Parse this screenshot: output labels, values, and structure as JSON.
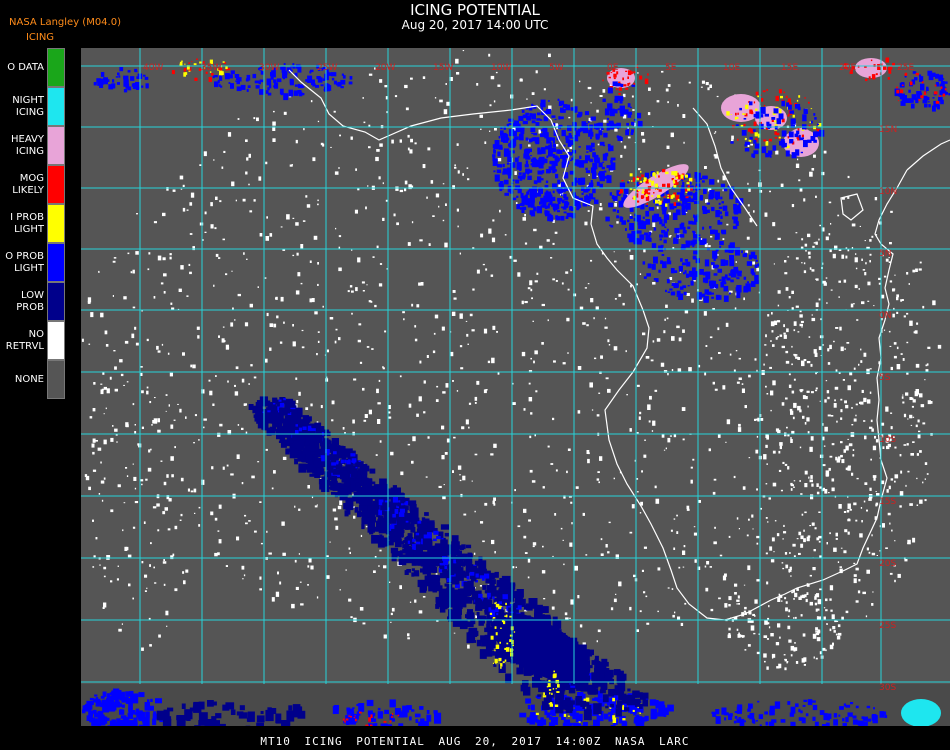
{
  "header": {
    "title": "ICING POTENTIAL",
    "subtitle": "Aug 20, 2017 14:00 UTC",
    "provider": "NASA Langley (M04.0)",
    "product": "ICING"
  },
  "legend": {
    "items": [
      {
        "line1": "O DATA",
        "line2": "",
        "color": "#1aa61a"
      },
      {
        "line1": "NIGHT",
        "line2": "ICING",
        "color": "#1ee6ef"
      },
      {
        "line1": "HEAVY",
        "line2": "ICING",
        "color": "#e8a4d8"
      },
      {
        "line1": "MOG",
        "line2": "LIKELY",
        "color": "#ff0000"
      },
      {
        "line1": "I PROB",
        "line2": "LIGHT",
        "color": "#ffff00"
      },
      {
        "line1": "O PROB",
        "line2": "LIGHT",
        "color": "#0000ff"
      },
      {
        "line1": "LOW",
        "line2": "PROB",
        "color": "#00008b"
      },
      {
        "line1": "NO",
        "line2": "RETRVL",
        "color": "#ffffff"
      },
      {
        "line1": "NONE",
        "line2": "",
        "color": "#555555"
      }
    ]
  },
  "map": {
    "background_color": "#555555",
    "grid_color": "#26d3d9",
    "coastline_color": "#ffffff",
    "label_color": "#cc2222",
    "lon_labels": [
      "40W",
      "35W",
      "30W",
      "25W",
      "20W",
      "15W",
      "10W",
      "5W",
      "0E",
      "5E",
      "10E",
      "15E",
      "20E",
      "25E",
      "30E"
    ],
    "lat_labels": [
      "15N",
      "10N",
      "5N",
      "0N",
      "5S",
      "10S",
      "15S",
      "20S",
      "25S",
      "30S",
      "35S"
    ]
  },
  "footer": {
    "text": "MT10 ICING POTENTIAL AUG 20, 2017 14:00Z NASA LARC"
  }
}
